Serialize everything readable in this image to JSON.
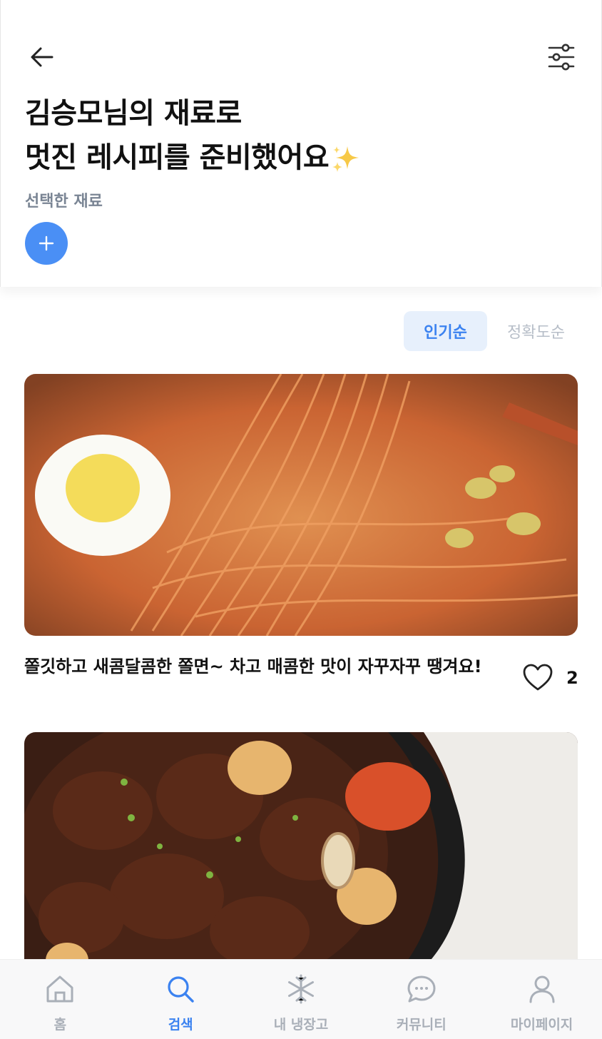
{
  "header": {
    "title_line1": "김승모님의 재료로",
    "title_line2": "멋진 레시피를 준비했어요",
    "selected_label": "선택한 재료",
    "add_label": "+"
  },
  "sort": {
    "tabs": [
      {
        "label": "인기순",
        "active": true
      },
      {
        "label": "정확도순",
        "active": false
      }
    ]
  },
  "recipes": [
    {
      "title": "쫄깃하고 새콤달콤한 쫄면~ 차고 매콤한 맛이 자꾸자꾸 땡겨요!",
      "likes": "2",
      "image": "spicy-jjolmyeon-noodles"
    },
    {
      "title": "",
      "image": "braised-short-ribs"
    }
  ],
  "tabbar": {
    "items": [
      {
        "label": "홈",
        "icon": "home-icon"
      },
      {
        "label": "검색",
        "icon": "search-icon",
        "active": true
      },
      {
        "label": "내 냉장고",
        "icon": "snowflake-icon"
      },
      {
        "label": "커뮤니티",
        "icon": "chat-bubble-icon"
      },
      {
        "label": "마이페이지",
        "icon": "person-icon"
      }
    ]
  },
  "colors": {
    "accent": "#3b82f0",
    "add_button": "#4a8ff5",
    "muted": "#7a8594",
    "inactive": "#a9afb8"
  }
}
